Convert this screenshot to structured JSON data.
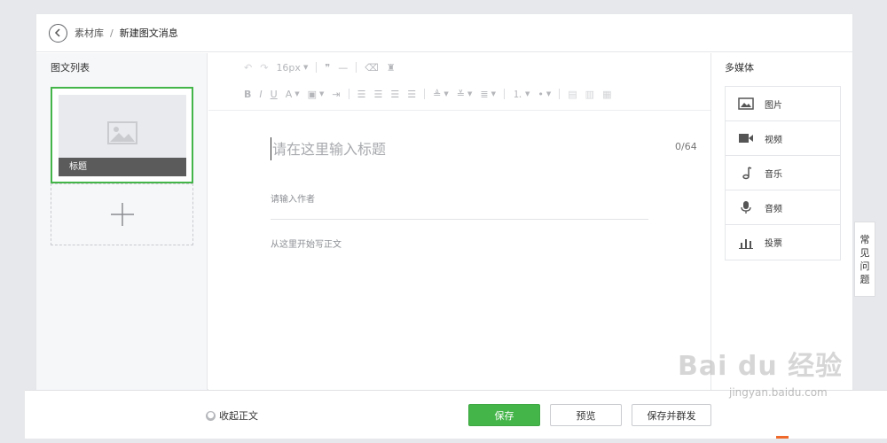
{
  "breadcrumb": {
    "parent": "素材库",
    "separator": "/",
    "current": "新建图文消息"
  },
  "left_panel": {
    "title": "图文列表",
    "card_caption": "标题"
  },
  "toolbar": {
    "font_size": "16px"
  },
  "editor": {
    "title_placeholder": "请在这里输入标题",
    "title_counter": "0/64",
    "author_placeholder": "请输入作者",
    "body_placeholder": "从这里开始写正文"
  },
  "right_panel": {
    "title": "多媒体",
    "items": [
      {
        "label": "图片",
        "icon": "image-icon"
      },
      {
        "label": "视频",
        "icon": "video-icon"
      },
      {
        "label": "音乐",
        "icon": "music-icon"
      },
      {
        "label": "音频",
        "icon": "audio-icon"
      },
      {
        "label": "投票",
        "icon": "vote-icon"
      }
    ]
  },
  "faq_tab": {
    "chars": [
      "常",
      "见",
      "问",
      "题"
    ]
  },
  "bottom_bar": {
    "collapse_label": "收起正文",
    "save_label": "保存",
    "preview_label": "预览",
    "send_label": "保存并群发"
  },
  "watermark": {
    "logo": "Bai du 经验",
    "url": "jingyan.baidu.com"
  },
  "colors": {
    "accent": "#44b549",
    "toolbar_icon": "#b4b6ba"
  }
}
